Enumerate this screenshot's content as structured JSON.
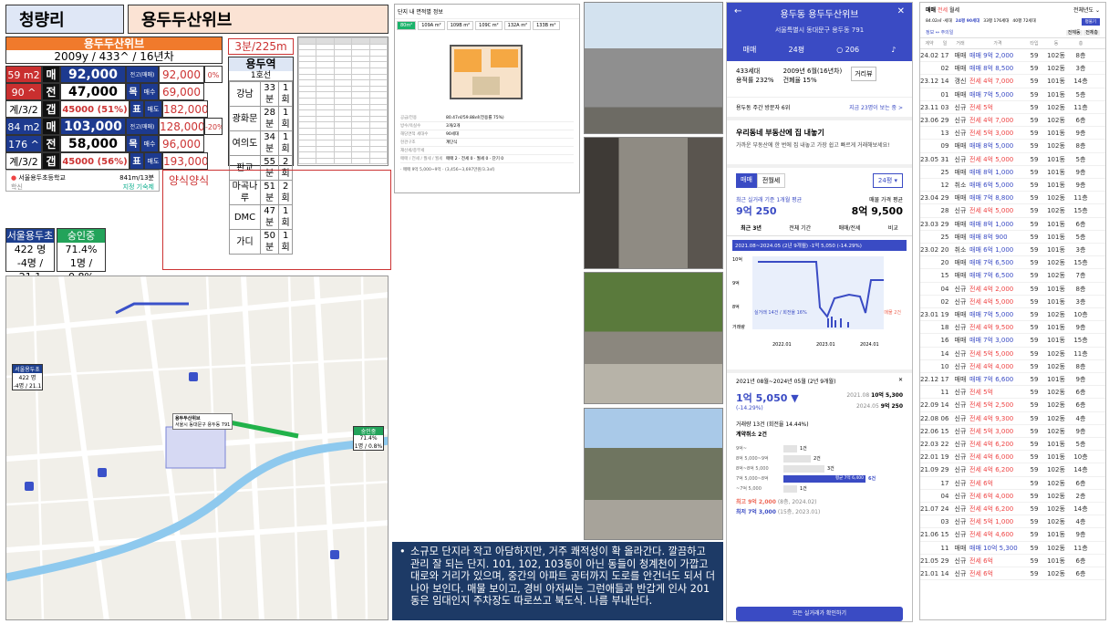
{
  "header": {
    "region": "청량리",
    "complex": "용두두산위브"
  },
  "summary": {
    "name": "용두두산위브",
    "meta": "2009y / 433^ / 16년차"
  },
  "prices": [
    {
      "size": "59 m2",
      "kind": "매",
      "val": "92,000",
      "lbl": "전고(매매)",
      "v2": "92,000",
      "pct": "0%"
    },
    {
      "size": "90 ^",
      "kind": "전",
      "val": "47,000",
      "lbl": "목",
      "sub": "매수",
      "v2": "69,000",
      "pct": ""
    },
    {
      "size": "계/3/2",
      "kind": "갭",
      "val": "45000 (51%)",
      "lbl": "표",
      "sub": "매도",
      "v2": "182,000",
      "pct": ""
    },
    {
      "size": "84 m2",
      "kind": "매",
      "val": "103,000",
      "lbl": "전고(매매)",
      "v2": "128,000",
      "pct": "-20%"
    },
    {
      "size": "176 ^",
      "kind": "전",
      "val": "58,000",
      "lbl": "목",
      "sub": "매수",
      "v2": "96,000",
      "pct": ""
    },
    {
      "size": "계/3/2",
      "kind": "갭",
      "val": "45000 (56%)",
      "lbl": "표",
      "sub": "매도",
      "v2": "193,000",
      "pct": ""
    }
  ],
  "subway": {
    "distance": "3분/225m",
    "station": "용두역",
    "line": "1호선",
    "rows": [
      [
        "강남",
        "33분",
        "1회"
      ],
      [
        "광화문",
        "28분",
        "1회"
      ],
      [
        "여의도",
        "34분",
        "1회"
      ],
      [
        "판교",
        "55분",
        "2회"
      ],
      [
        "마곡나루",
        "51분",
        "2회"
      ],
      [
        "DMC",
        "47분",
        "1회"
      ],
      [
        "가디",
        "50분",
        "1회"
      ]
    ]
  },
  "school_box": {
    "school": "서울용두초등학교",
    "dist": "841m/13분",
    "tag": "학신",
    "extra": "지정 기숙제"
  },
  "memo": {
    "title": "양식양식"
  },
  "schools": [
    {
      "name": "서울용두초",
      "stats": [
        "422 명",
        "-4명 / 21.1"
      ]
    },
    {
      "name": "숭인중",
      "stats": [
        "71.4%",
        "1명 / 0.8%"
      ]
    }
  ],
  "map": {
    "school1": "서울용두초",
    "school1_stat1": "422 명",
    "school1_stat2": "-4명 / 21.1",
    "school2": "숭인중",
    "school2_stat1": "71.4%",
    "school2_stat2": "1명 / 0.8%",
    "complex_label": "용두두산위브",
    "complex_addr": "서울시 동대문구 용두동 791"
  },
  "floorplan": {
    "title": "단지 내 면적별 정보",
    "tabs": [
      "80m²",
      "109A m²",
      "109B m²",
      "109C m²",
      "132A m²",
      "133B m²"
    ],
    "rows": [
      [
        "공급/전용",
        "80.47㎡/59.88㎡(전용률 75%)"
      ],
      [
        "방수/욕실수",
        "3개/2개"
      ],
      [
        "해당면적 세대수",
        "90세대"
      ],
      [
        "현관구조",
        "계단식"
      ],
      [
        "재산세/종부세",
        ""
      ],
      [
        "매매 / 전세 / 월세 / 월세",
        "매매 2 · 전세 0 · 월세 0 · 단기 0"
      ]
    ],
    "footer": "· 매매 9억 5,000~9억 · (3,456~3,697만원/3.3㎡)"
  },
  "explain": {
    "text": "소규모 단지라 작고 아담하지만, 거주 쾌적성이 확 올라간다. 깔끔하고 관리 잘 되는 단지. 101, 102, 103동이 아닌 동들이 청계천이 가깝고 대로와 거리가 있으며, 중간의 아파트 공터까지 도로를 안건너도 되서 더 나아 보인다. 매물 보이고, 경비 아저씨는 그런애들과 반갑게 인사 201동은 임대인지 주차장도 따로쓰고 북도식. 나름 부내난다."
  },
  "mobile": {
    "title": "용두동 용두두산위브",
    "addr": "서울특별시 동대문구 용두동 791",
    "tabs": [
      "매매",
      "24평",
      "206"
    ],
    "info1": "433세대",
    "info2": "용적률 232%",
    "info3": "2009년 6월(16년차)",
    "info4": "건폐율 15%",
    "btn": "거리뷰",
    "visitors": "용두동 주간 방문자 6위",
    "visitors_r": "지금 23명이 보는 중 >",
    "banner_t": "우리동네 부동산에 집 내놓기",
    "banner_s": "가까운 부동산에 한 번에 집 내놓고 가장 쉽고 빠르게 거래해보세요!",
    "seg": [
      "매매",
      "전월세"
    ],
    "pyeong": "24평 ▾",
    "recent_lbl": "최근 실거래 기준 1개월 평균",
    "recent_val": "9억 250",
    "ask_lbl": "매물 가격 평균",
    "ask_val": "8억 9,500",
    "ranges": [
      "최근 3년",
      "전체 기간",
      "매매/전세",
      "비교"
    ],
    "chart_hdr": "2021.08~2024.05 (2년 9개월)  -1억 5,050 (-14.29%)",
    "chart_x": [
      "2022.01",
      "2023.01",
      "2024.01"
    ],
    "chart_y": [
      "10억",
      "9억",
      "8억"
    ],
    "chart_lg1": "실거래 14건 / 회전율 16%",
    "chart_lg2": "매물 2건",
    "vol": "거래량",
    "p_range": "2021년 08월~2024년 05월 (2년 9개월)",
    "p_drop": "1억 5,050 ▼",
    "p_pct": "(-14.29%)",
    "p_r1l": "2021.08",
    "p_r1v": "10억 5,300",
    "p_r2l": "2024.05",
    "p_r2v": "9억 250",
    "vol_text": "거래량 13건 (회전율 14.44%)",
    "cancel": "계약취소 2건",
    "bars": [
      {
        "l": "9억~",
        "c": "1건",
        "v": 1
      },
      {
        "l": "8억 5,000~9억",
        "c": "2건",
        "v": 2
      },
      {
        "l": "8억~8억 5,000",
        "c": "3건",
        "v": 3
      },
      {
        "l": "7억 5,000~8억",
        "c": "6건",
        "v": 6,
        "hl": "평균 7억 6,400"
      },
      {
        "l": "~7억 5,000",
        "c": "1건",
        "v": 1
      }
    ],
    "max": "최고 9억 2,000",
    "max_s": "(8층, 2024.02)",
    "min": "최저 7억 3,000",
    "min_s": "(15층, 2023.01)",
    "bottom_btn": "모든 실거래가 확인하기"
  },
  "tx": {
    "tabs": [
      "매매",
      "전세",
      "월세"
    ],
    "scope": "전체년도",
    "areas": [
      "84.02㎡ -세대",
      "24평 90세대",
      "33평 176세대",
      "40평 72세대"
    ],
    "btn": "평물기",
    "sub_l": "정보 ↔ 주의일",
    "sub_r": [
      "전체동",
      "전체층"
    ],
    "headers": [
      "계약",
      "일",
      "거래",
      "가격",
      "타입",
      "동",
      "층"
    ],
    "rows": [
      [
        "24.02",
        "17",
        "매매",
        "매매 9억 2,000",
        "59",
        "102동",
        "8층"
      ],
      [
        "",
        "02",
        "매매",
        "매매 8억 8,500",
        "59",
        "102동",
        "3층"
      ],
      [
        "23.12",
        "14",
        "갱신",
        "전세 4억 7,000",
        "59",
        "101동",
        "14층"
      ],
      [
        "",
        "01",
        "매매",
        "매매 7억 5,000",
        "59",
        "101동",
        "5층"
      ],
      [
        "23.11",
        "03",
        "신규",
        "전세 5억",
        "59",
        "102동",
        "11층"
      ],
      [
        "23.06",
        "29",
        "신규",
        "전세 4억 7,000",
        "59",
        "102동",
        "6층"
      ],
      [
        "",
        "13",
        "신규",
        "전세 5억 3,000",
        "59",
        "101동",
        "9층"
      ],
      [
        "",
        "09",
        "매매",
        "매매 8억 5,000",
        "59",
        "102동",
        "8층"
      ],
      [
        "23.05",
        "31",
        "신규",
        "전세 4억 5,000",
        "59",
        "101동",
        "5층"
      ],
      [
        "",
        "25",
        "매매",
        "매매 8억 1,000",
        "59",
        "101동",
        "9층"
      ],
      [
        "",
        "12",
        "취소",
        "매매 6억 5,000",
        "59",
        "101동",
        "9층"
      ],
      [
        "23.04",
        "29",
        "매매",
        "매매 7억 8,800",
        "59",
        "102동",
        "11층"
      ],
      [
        "",
        "28",
        "신규",
        "전세 4억 5,000",
        "59",
        "102동",
        "15층"
      ],
      [
        "23.03",
        "29",
        "매매",
        "매매 8억 1,000",
        "59",
        "101동",
        "6층"
      ],
      [
        "",
        "25",
        "매매",
        "매매 8억 900",
        "59",
        "101동",
        "5층"
      ],
      [
        "23.02",
        "20",
        "취소",
        "매매 6억 1,000",
        "59",
        "101동",
        "3층"
      ],
      [
        "",
        "20",
        "매매",
        "매매 7억 6,500",
        "59",
        "102동",
        "15층"
      ],
      [
        "",
        "15",
        "매매",
        "매매 7억 6,500",
        "59",
        "102동",
        "7층"
      ],
      [
        "",
        "04",
        "신규",
        "전세 4억 2,000",
        "59",
        "101동",
        "8층"
      ],
      [
        "",
        "02",
        "신규",
        "전세 4억 5,000",
        "59",
        "101동",
        "3층"
      ],
      [
        "23.01",
        "19",
        "매매",
        "매매 7억 5,000",
        "59",
        "102동",
        "10층"
      ],
      [
        "",
        "18",
        "신규",
        "전세 4억 9,500",
        "59",
        "101동",
        "9층"
      ],
      [
        "",
        "16",
        "매매",
        "매매 7억 3,000",
        "59",
        "101동",
        "15층"
      ],
      [
        "",
        "14",
        "신규",
        "전세 5억 5,000",
        "59",
        "102동",
        "11층"
      ],
      [
        "",
        "10",
        "신규",
        "전세 4억 4,000",
        "59",
        "102동",
        "8층"
      ],
      [
        "22.12",
        "17",
        "매매",
        "매매 7억 6,600",
        "59",
        "101동",
        "9층"
      ],
      [
        "",
        "11",
        "신규",
        "전세 5억",
        "59",
        "102동",
        "6층"
      ],
      [
        "22.09",
        "14",
        "신규",
        "전세 5억 2,500",
        "59",
        "102동",
        "6층"
      ],
      [
        "22.08",
        "06",
        "신규",
        "전세 4억 9,300",
        "59",
        "102동",
        "4층"
      ],
      [
        "22.06",
        "15",
        "신규",
        "전세 5억 3,000",
        "59",
        "102동",
        "9층"
      ],
      [
        "22.03",
        "22",
        "신규",
        "전세 4억 6,200",
        "59",
        "101동",
        "5층"
      ],
      [
        "22.01",
        "19",
        "신규",
        "전세 4억 6,000",
        "59",
        "101동",
        "10층"
      ],
      [
        "21.09",
        "29",
        "신규",
        "전세 4억 6,200",
        "59",
        "102동",
        "14층"
      ],
      [
        "",
        "17",
        "신규",
        "전세 6억",
        "59",
        "102동",
        "6층"
      ],
      [
        "",
        "04",
        "신규",
        "전세 6억 4,000",
        "59",
        "102동",
        "2층"
      ],
      [
        "21.07",
        "24",
        "신규",
        "전세 4억 6,200",
        "59",
        "102동",
        "14층"
      ],
      [
        "",
        "03",
        "신규",
        "전세 5억 1,000",
        "59",
        "102동",
        "4층"
      ],
      [
        "21.06",
        "15",
        "신규",
        "전세 4억 4,600",
        "59",
        "101동",
        "9층"
      ],
      [
        "",
        "11",
        "매매",
        "매매 10억 5,300",
        "59",
        "102동",
        "11층"
      ],
      [
        "21.05",
        "29",
        "신규",
        "전세 6억",
        "59",
        "101동",
        "6층"
      ],
      [
        "21.01",
        "14",
        "신규",
        "전세 6억",
        "59",
        "102동",
        "6층"
      ]
    ]
  }
}
